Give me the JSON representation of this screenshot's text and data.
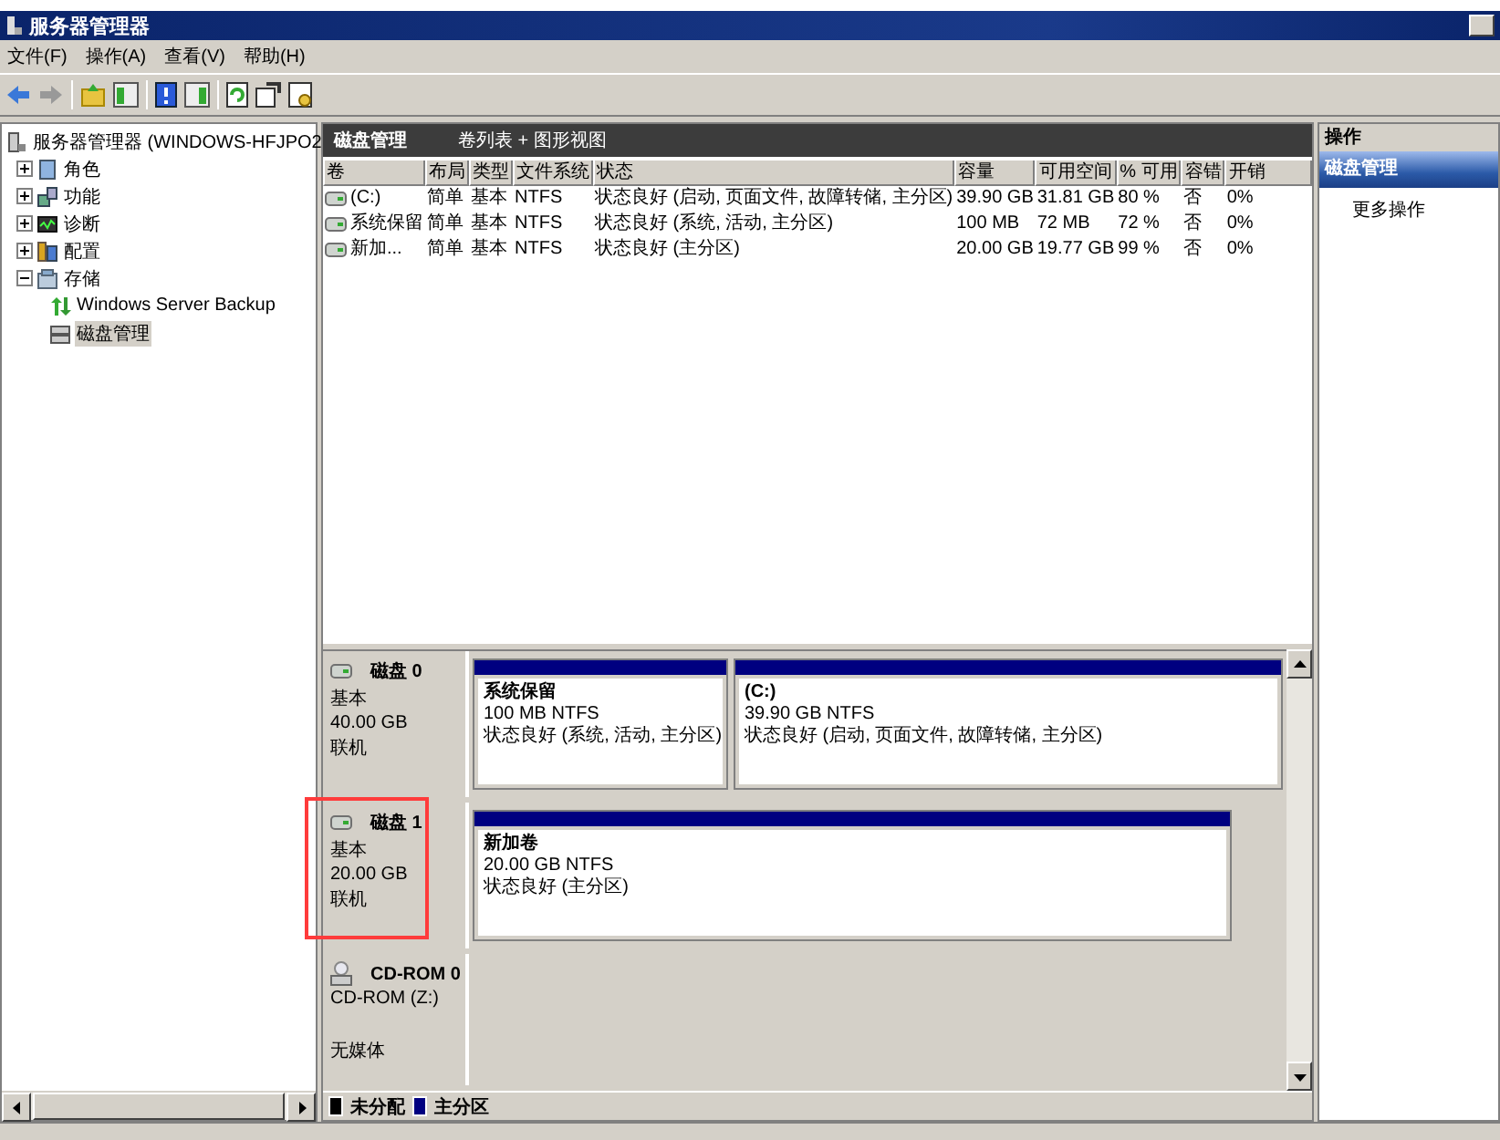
{
  "window": {
    "title": "服务器管理器"
  },
  "menu": [
    "文件(F)",
    "操作(A)",
    "查看(V)",
    "帮助(H)"
  ],
  "tree": {
    "label": "服务器管理器 (WINDOWS-HFJPO2",
    "selected": false,
    "children": [
      {
        "label": "角色",
        "expanded": false,
        "selected": false
      },
      {
        "label": "功能",
        "expanded": false,
        "selected": false
      },
      {
        "label": "诊断",
        "expanded": false,
        "selected": false
      },
      {
        "label": "配置",
        "expanded": false,
        "selected": false
      },
      {
        "label": "存储",
        "expanded": true,
        "selected": false,
        "children": [
          {
            "label": "Windows Server Backup",
            "selected": false
          },
          {
            "label": "磁盘管理",
            "selected": true
          }
        ]
      }
    ]
  },
  "center": {
    "title": "磁盘管理",
    "view": "卷列表 + 图形视图"
  },
  "table": {
    "columns": [
      "卷",
      "布局",
      "类型",
      "文件系统",
      "状态",
      "容量",
      "可用空间",
      "% 可用",
      "容错",
      "开销"
    ],
    "rows": [
      [
        "(C:)",
        "简单",
        "基本",
        "NTFS",
        "状态良好 (启动, 页面文件, 故障转储, 主分区)",
        "39.90 GB",
        "31.81 GB",
        "80 %",
        "否",
        "0%"
      ],
      [
        "系统保留",
        "简单",
        "基本",
        "NTFS",
        "状态良好 (系统, 活动, 主分区)",
        "100 MB",
        "72 MB",
        "72 %",
        "否",
        "0%"
      ],
      [
        "新加...",
        "简单",
        "基本",
        "NTFS",
        "状态良好 (主分区)",
        "20.00 GB",
        "19.77 GB",
        "99 %",
        "否",
        "0%"
      ]
    ]
  },
  "disks": [
    {
      "kind": "disk",
      "name": "磁盘 0",
      "type": "基本",
      "size": "40.00 GB",
      "status": "联机",
      "highlighted": false,
      "partitions": [
        {
          "name": "系统保留",
          "size": "100 MB NTFS",
          "status": "状态良好 (系统, 活动, 主分区)"
        },
        {
          "name": "(C:)",
          "size": "39.90 GB NTFS",
          "status": "状态良好 (启动, 页面文件, 故障转储, 主分区)"
        }
      ]
    },
    {
      "kind": "disk",
      "name": "磁盘 1",
      "type": "基本",
      "size": "20.00 GB",
      "status": "联机",
      "highlighted": true,
      "partitions": [
        {
          "name": "新加卷",
          "size": "20.00 GB NTFS",
          "status": "状态良好 (主分区)"
        }
      ]
    },
    {
      "kind": "cdrom",
      "name": "CD-ROM 0",
      "type": "CD-ROM (Z:)",
      "status": "无媒体",
      "highlighted": false
    }
  ],
  "legend": [
    {
      "label": "未分配",
      "color": "#000000"
    },
    {
      "label": "主分区",
      "color": "#000080"
    }
  ],
  "actions": {
    "title": "操作",
    "section": "磁盘管理",
    "items": [
      "更多操作"
    ]
  }
}
